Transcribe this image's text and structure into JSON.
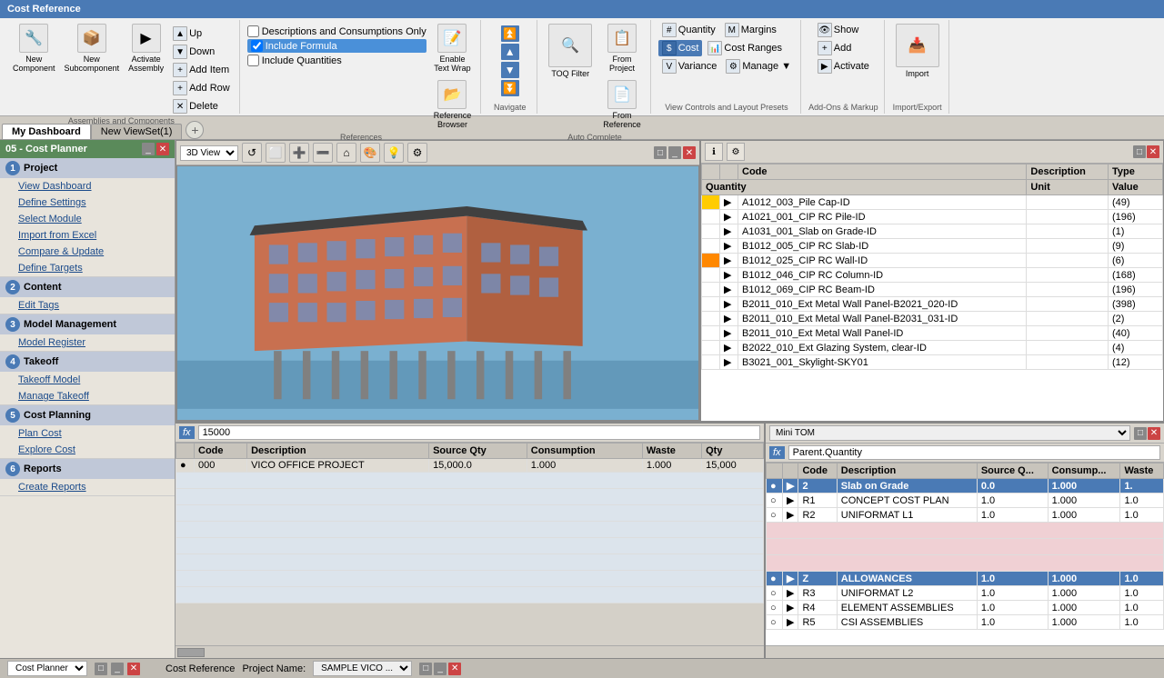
{
  "titleBar": {
    "label": "Cost Reference"
  },
  "ribbon": {
    "groups": [
      {
        "name": "assemblies-components",
        "label": "Assemblies and Components",
        "buttons": [
          {
            "id": "new-component",
            "label": "New Component",
            "icon": "🔧"
          },
          {
            "id": "new-subcomponent",
            "label": "New Subcomponent",
            "icon": "📦"
          },
          {
            "id": "activate-assembly",
            "label": "Activate Assembly",
            "icon": "▶"
          }
        ],
        "smallButtons": [
          {
            "id": "up",
            "label": "Up",
            "icon": "▲"
          },
          {
            "id": "down",
            "label": "Down",
            "icon": "▼"
          },
          {
            "id": "add-item",
            "label": "Add Item",
            "icon": "+"
          },
          {
            "id": "add-row",
            "label": "Add Row",
            "icon": "+"
          },
          {
            "id": "delete",
            "label": "Delete",
            "icon": "✕"
          }
        ]
      },
      {
        "name": "references",
        "label": "References",
        "checkboxes": [
          {
            "id": "descriptions",
            "label": "Descriptions and Consumptions Only",
            "checked": false
          },
          {
            "id": "include-formula",
            "label": "Include Formula",
            "checked": true,
            "active": true
          },
          {
            "id": "include-quantities",
            "label": "Include Quantities",
            "checked": false
          }
        ],
        "buttons": [
          {
            "id": "enable-text-wrap",
            "label": "Enable Text Wrap",
            "icon": "📝"
          },
          {
            "id": "reference-browser",
            "label": "Reference Browser",
            "icon": "📂"
          }
        ]
      },
      {
        "name": "navigate",
        "label": "Navigate",
        "arrows": [
          "▲▲",
          "▲",
          "▼",
          "▼▼"
        ]
      },
      {
        "name": "auto-complete",
        "label": "Auto Complete",
        "buttons": [
          {
            "id": "toq-filter",
            "label": "TOQ Filter",
            "icon": "🔍"
          }
        ],
        "subButtons": [
          {
            "id": "from-project",
            "label": "From Project",
            "icon": "📋"
          },
          {
            "id": "from-reference",
            "label": "From Reference",
            "icon": "📄"
          }
        ]
      },
      {
        "name": "view-controls",
        "label": "View Controls and Layout Presets",
        "buttons": [
          {
            "id": "quantity",
            "label": "Quantity",
            "icon": "#"
          },
          {
            "id": "margins",
            "label": "Margins",
            "icon": "M"
          },
          {
            "id": "cost",
            "label": "Cost",
            "icon": "$",
            "active": true
          },
          {
            "id": "cost-ranges",
            "label": "Cost Ranges",
            "icon": "📊"
          },
          {
            "id": "variance",
            "label": "Variance",
            "icon": "V"
          },
          {
            "id": "manage",
            "label": "Manage",
            "icon": "⚙"
          }
        ]
      },
      {
        "name": "add-ons",
        "label": "Add-Ons & Markup",
        "buttons": [
          {
            "id": "show",
            "label": "Show",
            "icon": "👁"
          },
          {
            "id": "add-markup",
            "label": "Add",
            "icon": "+"
          },
          {
            "id": "activate-markup",
            "label": "Activate",
            "icon": "▶"
          }
        ]
      },
      {
        "name": "import-export",
        "label": "Import/Export",
        "buttons": [
          {
            "id": "import",
            "label": "Import",
            "icon": "📥"
          }
        ]
      }
    ]
  },
  "sidebar": {
    "header": "05 - Cost Planner",
    "sections": [
      {
        "num": "1",
        "title": "Project",
        "items": [
          "View Dashboard",
          "Define Settings",
          "Select Module",
          "Import from Excel",
          "Compare & Update",
          "Define Targets"
        ]
      },
      {
        "num": "2",
        "title": "Content",
        "items": [
          "Edit Tags"
        ]
      },
      {
        "num": "3",
        "title": "Model Management",
        "items": [
          "Model Register"
        ]
      },
      {
        "num": "4",
        "title": "Takeoff",
        "items": [
          "Takeoff Model",
          "Manage Takeoff"
        ]
      },
      {
        "num": "5",
        "title": "Cost Planning",
        "items": [
          "Plan Cost",
          "Explore Cost"
        ]
      },
      {
        "num": "6",
        "title": "Reports",
        "items": [
          "Create Reports"
        ]
      }
    ]
  },
  "tabs": {
    "tabs": [
      {
        "id": "my-dashboard",
        "label": "My Dashboard",
        "active": true
      },
      {
        "id": "new-viewset",
        "label": "New ViewSet(1)",
        "active": false
      }
    ]
  },
  "view3d": {
    "label": "3D View",
    "tools": [
      "↺",
      "⬜",
      "➕",
      "➖",
      "🔍",
      "⌂",
      "🎨",
      "💡",
      "⚙"
    ]
  },
  "rightPanel": {
    "columns": [
      "Info",
      "Code",
      "Description",
      "Type"
    ],
    "subColumns": [
      "Quantity",
      "Unit",
      "Value"
    ],
    "rows": [
      {
        "code": "A1012_003_Pile Cap-ID",
        "value": "(49)"
      },
      {
        "code": "A1021_001_CIP RC Pile-ID",
        "value": "(196)"
      },
      {
        "code": "A1031_001_Slab on Grade-ID",
        "value": "(1)"
      },
      {
        "code": "B1012_005_CIP RC Slab-ID",
        "value": "(9)"
      },
      {
        "code": "B1012_025_CIP RC Wall-ID",
        "value": "(6)"
      },
      {
        "code": "B1012_046_CIP RC Column-ID",
        "value": "(168)"
      },
      {
        "code": "B1012_069_CIP RC Beam-ID",
        "value": "(196)"
      },
      {
        "code": "B2011_010_Ext Metal Wall Panel-B2021_020-ID",
        "value": "(398)"
      },
      {
        "code": "B2011_010_Ext Metal Wall Panel-B2031_031-ID",
        "value": "(2)"
      },
      {
        "code": "B2011_010_Ext Metal Wall Panel-ID",
        "value": "(40)"
      },
      {
        "code": "B2022_010_Ext Glazing System, clear-ID",
        "value": "(4)"
      },
      {
        "code": "B3021_001_Skylight-SKY01",
        "value": "(12)"
      }
    ]
  },
  "formulaBar": {
    "label": "fx",
    "value": "15000",
    "rightLabel": "fx",
    "rightValue": "Parent.Quantity"
  },
  "costGrid": {
    "columns": [
      "Code",
      "Description",
      "Source Qty",
      "Consumption",
      "Waste",
      "Qty"
    ],
    "rows": [
      {
        "code": "000",
        "description": "VICO OFFICE PROJECT",
        "sourceQty": "15,000.0",
        "consumption": "1.000",
        "waste": "1.000",
        "qty": "15,000"
      }
    ]
  },
  "miniTom": {
    "label": "Mini TOM",
    "selectValue": "Mini TOM",
    "columns": [
      "Code",
      "Description",
      "Source Q...",
      "Consump...",
      "Waste"
    ],
    "rows": [
      {
        "code": "2",
        "description": "Slab on Grade",
        "sourceQ": "0.0",
        "consump": "1.000",
        "waste": "1.",
        "class": "tom-row-slab"
      },
      {
        "code": "R1",
        "description": "CONCEPT COST PLAN",
        "sourceQ": "1.0",
        "consump": "1.000",
        "waste": "1.0",
        "class": "tom-row-r1"
      },
      {
        "code": "R2",
        "description": "UNIFORMAT L1",
        "sourceQ": "1.0",
        "consump": "1.000",
        "waste": "1.0",
        "class": "tom-row-r2"
      },
      {
        "code": "",
        "description": "",
        "sourceQ": "",
        "consump": "",
        "waste": "",
        "class": "tom-row-pink"
      },
      {
        "code": "",
        "description": "",
        "sourceQ": "",
        "consump": "",
        "waste": "",
        "class": "tom-row-pink"
      },
      {
        "code": "",
        "description": "",
        "sourceQ": "",
        "consump": "",
        "waste": "",
        "class": "tom-row-pink"
      },
      {
        "code": "Z",
        "description": "ALLOWANCES",
        "sourceQ": "1.0",
        "consump": "1.000",
        "waste": "1.0",
        "class": "tom-row-allowances"
      },
      {
        "code": "R3",
        "description": "UNIFORMAT L2",
        "sourceQ": "1.0",
        "consump": "1.000",
        "waste": "1.0",
        "class": "tom-row-r3"
      },
      {
        "code": "R4",
        "description": "ELEMENT ASSEMBLIES",
        "sourceQ": "1.0",
        "consump": "1.000",
        "waste": "1.0",
        "class": "tom-row-r4"
      },
      {
        "code": "R5",
        "description": "CSI ASSEMBLIES",
        "sourceQ": "1.0",
        "consump": "1.000",
        "waste": "1.0",
        "class": "tom-row-r5"
      }
    ]
  },
  "statusBar": {
    "costPlannerLabel": "Cost Planner",
    "costReferenceLabel": "Cost Reference",
    "projectNameLabel": "Project Name:",
    "projectName": "SAMPLE VICO ..."
  }
}
